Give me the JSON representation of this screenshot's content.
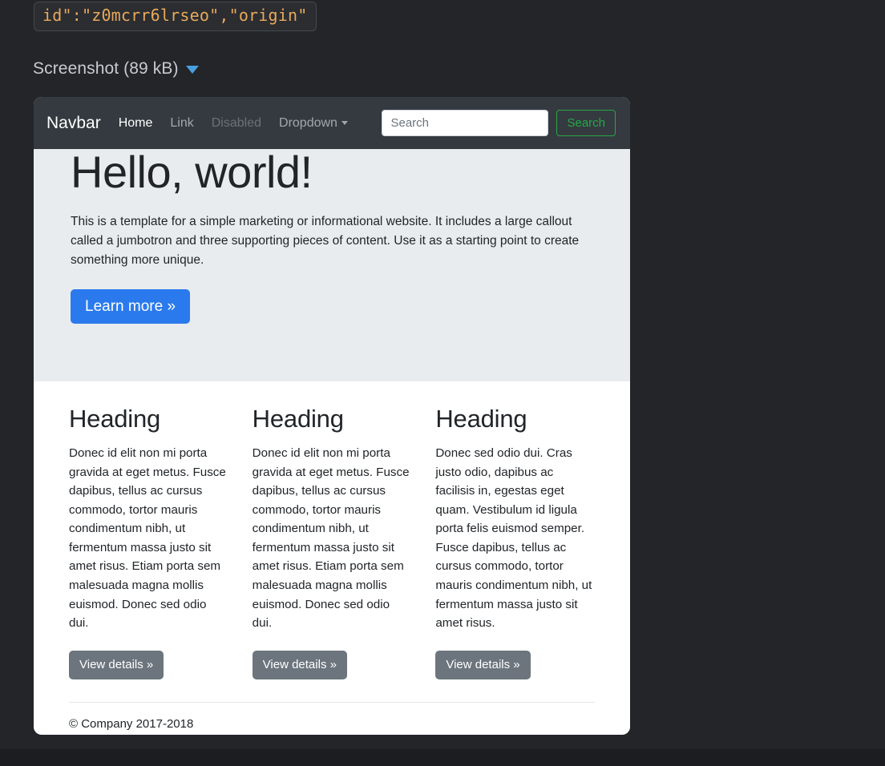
{
  "attachment": {
    "code_chip": "id\":\"z0mcrr6lrseo\",\"origin\"",
    "label": "Screenshot (89 kB)",
    "caret_icon": "caret-down-icon",
    "caret_color": "#4a9fe0"
  },
  "navbar": {
    "brand": "Navbar",
    "background": "#343a40",
    "links": [
      {
        "label": "Home",
        "state": "active"
      },
      {
        "label": "Link",
        "state": "normal"
      },
      {
        "label": "Disabled",
        "state": "disabled"
      },
      {
        "label": "Dropdown",
        "state": "dropdown"
      }
    ],
    "search": {
      "placeholder": "Search",
      "value": "",
      "button_label": "Search",
      "button_color": "#28a745"
    }
  },
  "jumbotron": {
    "background": "#e9ecef",
    "title": "Hello, world!",
    "lead": "This is a template for a simple marketing or informational website. It includes a large callout called a jumbotron and three supporting pieces of content. Use it as a starting point to create something more unique.",
    "cta_label": "Learn more »",
    "cta_color": "#2a7aee"
  },
  "columns": [
    {
      "heading": "Heading",
      "body": "Donec id elit non mi porta gravida at eget metus. Fusce dapibus, tellus ac cursus commodo, tortor mauris condimentum nibh, ut fermentum massa justo sit amet risus. Etiam porta sem malesuada magna mollis euismod. Donec sed odio dui.",
      "button_label": "View details »"
    },
    {
      "heading": "Heading",
      "body": "Donec id elit non mi porta gravida at eget metus. Fusce dapibus, tellus ac cursus commodo, tortor mauris condimentum nibh, ut fermentum massa justo sit amet risus. Etiam porta sem malesuada magna mollis euismod. Donec sed odio dui.",
      "button_label": "View details »"
    },
    {
      "heading": "Heading",
      "body": "Donec sed odio dui. Cras justo odio, dapibus ac facilisis in, egestas eget quam. Vestibulum id ligula porta felis euismod semper. Fusce dapibus, tellus ac cursus commodo, tortor mauris condimentum nibh, ut fermentum massa justo sit amet risus.",
      "button_label": "View details »"
    }
  ],
  "footer": {
    "copyright": "© Company 2017-2018"
  },
  "page": {
    "background": "#232529",
    "bottom_bar_color": "#1b1d21"
  }
}
